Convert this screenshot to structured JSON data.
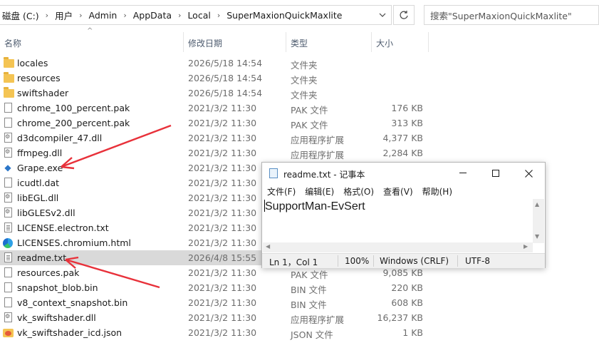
{
  "address": {
    "crumbs": [
      "磁盘 (C:)",
      "用户",
      "Admin",
      "AppData",
      "Local",
      "SuperMaxionQuickMaxlite"
    ],
    "search_placeholder": "搜索\"SuperMaxionQuickMaxlite\""
  },
  "columns": {
    "name": "名称",
    "date": "修改日期",
    "type": "类型",
    "size": "大小"
  },
  "files": [
    {
      "name": "locales",
      "date": "2026/5/18 14:54",
      "type": "文件夹",
      "size": "",
      "icon": "folder-icon"
    },
    {
      "name": "resources",
      "date": "2026/5/18 14:54",
      "type": "文件夹",
      "size": "",
      "icon": "folder-icon"
    },
    {
      "name": "swiftshader",
      "date": "2026/5/18 14:54",
      "type": "文件夹",
      "size": "",
      "icon": "folder-icon"
    },
    {
      "name": "chrome_100_percent.pak",
      "date": "2021/3/2 11:30",
      "type": "PAK 文件",
      "size": "176 KB",
      "icon": "file-icon"
    },
    {
      "name": "chrome_200_percent.pak",
      "date": "2021/3/2 11:30",
      "type": "PAK 文件",
      "size": "313 KB",
      "icon": "file-icon"
    },
    {
      "name": "d3dcompiler_47.dll",
      "date": "2021/3/2 11:30",
      "type": "应用程序扩展",
      "size": "4,377 KB",
      "icon": "dll-icon"
    },
    {
      "name": "ffmpeg.dll",
      "date": "2021/3/2 11:30",
      "type": "应用程序扩展",
      "size": "2,284 KB",
      "icon": "dll-icon"
    },
    {
      "name": "Grape.exe",
      "date": "2021/3/2 11:30",
      "type": "",
      "size": "",
      "icon": "exe-icon"
    },
    {
      "name": "icudtl.dat",
      "date": "2021/3/2 11:30",
      "type": "",
      "size": "",
      "icon": "file-icon"
    },
    {
      "name": "libEGL.dll",
      "date": "2021/3/2 11:30",
      "type": "",
      "size": "",
      "icon": "dll-icon"
    },
    {
      "name": "libGLESv2.dll",
      "date": "2021/3/2 11:30",
      "type": "",
      "size": "",
      "icon": "dll-icon"
    },
    {
      "name": "LICENSE.electron.txt",
      "date": "2021/3/2 11:30",
      "type": "",
      "size": "",
      "icon": "text-file-icon"
    },
    {
      "name": "LICENSES.chromium.html",
      "date": "2021/3/2 11:30",
      "type": "",
      "size": "",
      "icon": "edge-icon"
    },
    {
      "name": "readme.txt",
      "date": "2026/4/8 15:55",
      "type": "",
      "size": "",
      "icon": "text-file-icon"
    },
    {
      "name": "resources.pak",
      "date": "2021/3/2 11:30",
      "type": "PAK 文件",
      "size": "9,085 KB",
      "icon": "file-icon"
    },
    {
      "name": "snapshot_blob.bin",
      "date": "2021/3/2 11:30",
      "type": "BIN 文件",
      "size": "220 KB",
      "icon": "file-icon"
    },
    {
      "name": "v8_context_snapshot.bin",
      "date": "2021/3/2 11:30",
      "type": "BIN 文件",
      "size": "608 KB",
      "icon": "file-icon"
    },
    {
      "name": "vk_swiftshader.dll",
      "date": "2021/3/2 11:30",
      "type": "应用程序扩展",
      "size": "16,237 KB",
      "icon": "dll-icon"
    },
    {
      "name": "vk_swiftshader_icd.json",
      "date": "2021/3/2 11:30",
      "type": "JSON 文件",
      "size": "1 KB",
      "icon": "json-icon"
    }
  ],
  "notepad": {
    "title": "readme.txt - 记事本",
    "menu": [
      "文件(F)",
      "编辑(E)",
      "格式(O)",
      "查看(V)",
      "帮助(H)"
    ],
    "content": "SupportMan-EvSert",
    "status": {
      "position": "Ln 1，Col 1",
      "zoom": "100%",
      "eol": "Windows (CRLF)",
      "encoding": "UTF-8"
    }
  },
  "annotation_color": "#e8313a"
}
